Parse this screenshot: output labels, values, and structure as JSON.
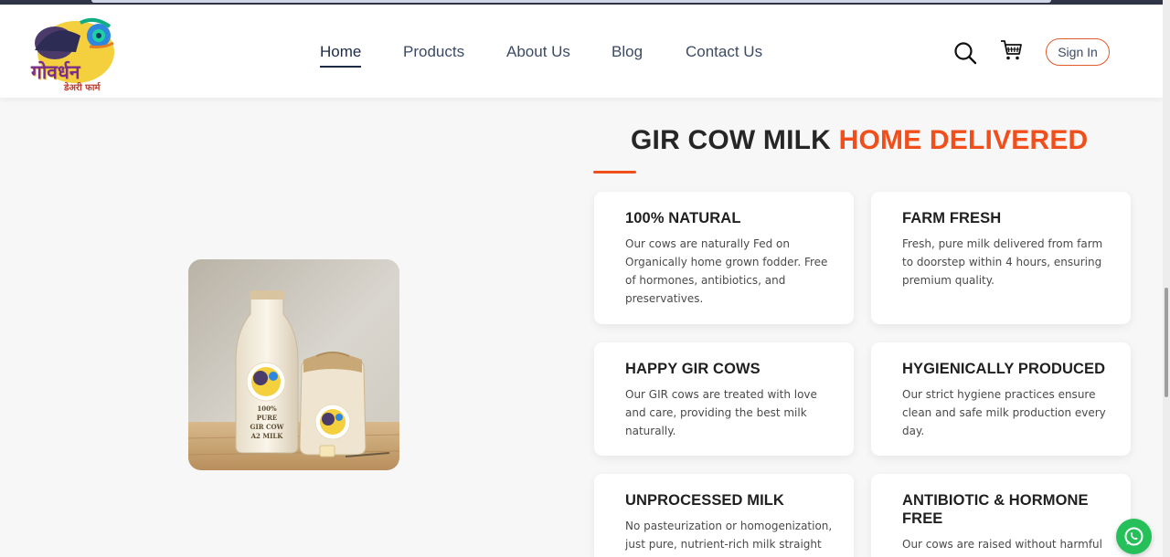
{
  "logo": {
    "title": "गोवर्धन",
    "subtitle": "डेअरी फार्म"
  },
  "nav": {
    "items": [
      {
        "label": "Home",
        "active": true
      },
      {
        "label": "Products",
        "active": false
      },
      {
        "label": "About Us",
        "active": false
      },
      {
        "label": "Blog",
        "active": false
      },
      {
        "label": "Contact Us",
        "active": false
      }
    ]
  },
  "header_actions": {
    "search_icon": "search-icon",
    "cart_icon": "cart-icon",
    "signin_label": "Sign In"
  },
  "product_image": {
    "bottle_label": [
      "100%",
      "PURE",
      "GIR COW",
      "A2 MILK"
    ]
  },
  "section": {
    "title_main": "GIR COW MILK",
    "title_accent": "HOME DELIVERED",
    "accent_color": "#f04e1b"
  },
  "features": [
    {
      "title": "100% NATURAL",
      "text": "Our cows are naturally Fed on Organically home grown fodder. Free of hormones, antibiotics, and preservatives."
    },
    {
      "title": "FARM FRESH",
      "text": "Fresh, pure milk delivered from farm to doorstep within 4 hours, ensuring premium quality."
    },
    {
      "title": "HAPPY GIR COWS",
      "text": "Our GIR cows are treated with love and care, providing the best milk naturally."
    },
    {
      "title": "HYGIENICALLY PRODUCED",
      "text": "Our strict hygiene practices ensure clean and safe milk production every day."
    },
    {
      "title": "UNPROCESSED MILK",
      "text": "No pasteurization or homogenization, just pure, nutrient-rich milk straight from the farm."
    },
    {
      "title": "ANTIBIOTIC & HORMONE FREE",
      "text": "Our cows are raised without harmful antibiotics or growth hormones."
    }
  ],
  "whatsapp": {
    "icon": "whatsapp-icon",
    "color": "#25c05a"
  }
}
